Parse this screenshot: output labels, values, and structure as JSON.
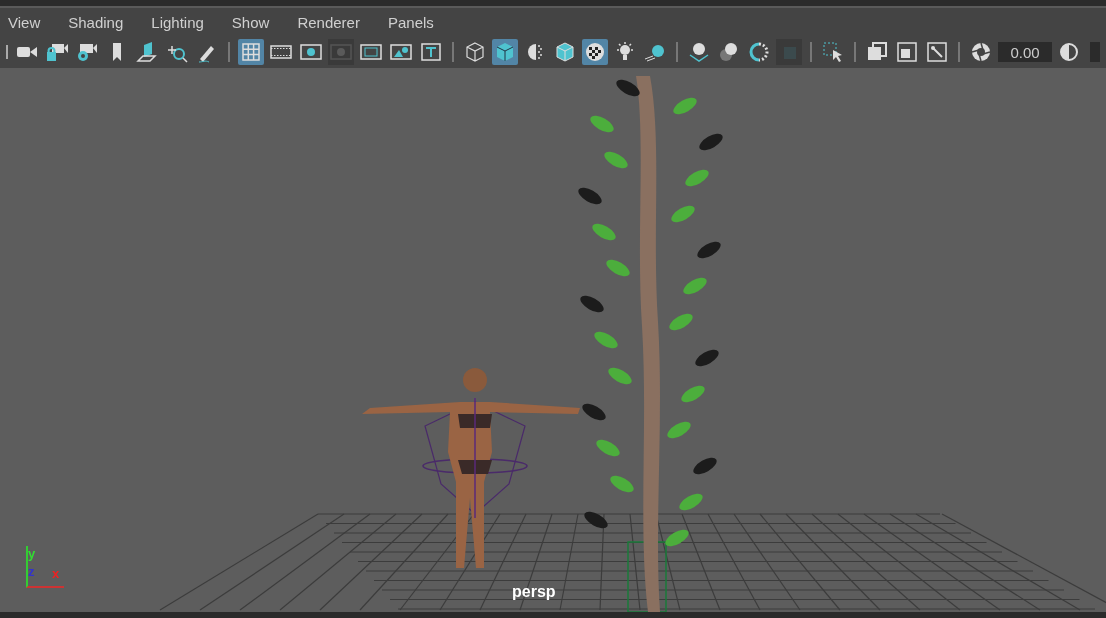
{
  "menu": [
    "View",
    "Shading",
    "Lighting",
    "Show",
    "Renderer",
    "Panels"
  ],
  "toolbar": [
    {
      "kind": "camera",
      "selected": false
    },
    {
      "kind": "camera-lock",
      "selected": false
    },
    {
      "kind": "camera-gear",
      "selected": false
    },
    {
      "kind": "bookmark",
      "selected": false
    },
    {
      "kind": "plane",
      "selected": false
    },
    {
      "kind": "zoom",
      "selected": false
    },
    {
      "kind": "pencil",
      "selected": false
    },
    {
      "kind": "divider"
    },
    {
      "kind": "grid",
      "selected": true
    },
    {
      "kind": "film",
      "selected": false
    },
    {
      "kind": "dot-frame",
      "selected": false
    },
    {
      "kind": "dark-frame",
      "selected": false
    },
    {
      "kind": "safe",
      "selected": false
    },
    {
      "kind": "image",
      "selected": false
    },
    {
      "kind": "text-frame",
      "selected": false
    },
    {
      "kind": "divider"
    },
    {
      "kind": "wire-cube",
      "selected": false
    },
    {
      "kind": "solid-cube",
      "selected": true
    },
    {
      "kind": "half-sphere",
      "selected": false
    },
    {
      "kind": "edged-cube",
      "selected": false
    },
    {
      "kind": "checker",
      "selected": true
    },
    {
      "kind": "bulb",
      "selected": false
    },
    {
      "kind": "lit-sphere",
      "selected": false
    },
    {
      "kind": "divider"
    },
    {
      "kind": "sphere-plane",
      "selected": false
    },
    {
      "kind": "spheres",
      "selected": false
    },
    {
      "kind": "ring",
      "selected": false
    },
    {
      "kind": "dark-square",
      "selected": false
    },
    {
      "kind": "divider"
    },
    {
      "kind": "select-box",
      "selected": false
    },
    {
      "kind": "divider"
    },
    {
      "kind": "stack",
      "selected": false
    },
    {
      "kind": "stack-small",
      "selected": false
    },
    {
      "kind": "picture-frame",
      "selected": false
    },
    {
      "kind": "divider"
    },
    {
      "kind": "aperture",
      "selected": false
    },
    {
      "kind": "field",
      "value": "0.00"
    },
    {
      "kind": "contrast",
      "selected": false
    },
    {
      "kind": "field-cut"
    }
  ],
  "viewport": {
    "camera": "persp",
    "axes": {
      "y": "y",
      "z": "z",
      "x": "x"
    }
  }
}
